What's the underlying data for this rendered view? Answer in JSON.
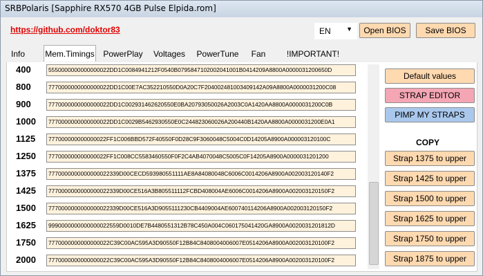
{
  "window": {
    "title": "SRBPolaris [Sapphire RX570 4GB Pulse Elpida.rom]"
  },
  "header": {
    "link": "https://github.com/doktor83",
    "language": "EN",
    "open_bios": "Open BIOS",
    "save_bios": "Save BIOS"
  },
  "tabs": [
    "Info",
    "Mem.Timings",
    "PowerPlay",
    "Voltages",
    "PowerTune",
    "Fan",
    "!IMPORTANT!"
  ],
  "active_tab": "Mem.Timings",
  "timings": [
    {
      "freq": "400",
      "strap": "5550000000000000022DD1C0084941212F0540B0795847102002041001B0414209A8800A0000031200650D"
    },
    {
      "freq": "800",
      "strap": "7770000000000000022DD1C00E7AC352210550D0A20C7F204002481003409142A09A8800A0000031200C08"
    },
    {
      "freq": "900",
      "strap": "7770000000000000022DD1C002931462620550E0BA20793050026A2003C0A1420AA8800A0000031200C0B"
    },
    {
      "freq": "1000",
      "strap": "7770000000000000022DD1C0029B5462930550E0C244823060026A200440B1420AA8800A0000031200E0A1"
    },
    {
      "freq": "1125",
      "strap": "777000000000000022FF1C006BBD572F40550F0D28C9F3060048C5004C0D14205A8900A000003120100C"
    },
    {
      "freq": "1250",
      "strap": "777000000000000022FF1C008CC5583460550F0F2C4AB4070048C5005C0F14205A8900A0000031201200"
    },
    {
      "freq": "1375",
      "strap": "7770000000000000022339D00CECD593980551111AE8A84080048C6006C0014206A8900A002003120140F2"
    },
    {
      "freq": "1425",
      "strap": "7770000000000000022339D00CE516A3B805511112FCBD408004AE6006C0014206A8900A002003120150F2"
    },
    {
      "freq": "1500",
      "strap": "7770000000000000022339D00CE516A3D9055111230CB4409004AE600740114206A8900A002003120150F2"
    },
    {
      "freq": "1625",
      "strap": "9990000000000000022559D0010DE7B4480551312B78C450A004C060175041420GA8900A0020031201812D"
    },
    {
      "freq": "1750",
      "strap": "7770000000000000022C39C00AC595A3D90550F12B84C8408004006007E0514206A8900A002003120100F2"
    },
    {
      "freq": "2000",
      "strap": "7770000000000000022C39C00AC595A3D90550F12B84C8408004006007E0514206A8900A002003120100F2"
    }
  ],
  "actions": {
    "default_values": "Default values",
    "strap_editor": "STRAP EDITOR",
    "pimp_my_straps": "PIMP MY STRAPS",
    "copy_heading": "COPY",
    "copy_buttons": [
      "Strap 1375 to upper",
      "Strap 1425 to upper",
      "Strap 1500 to upper",
      "Strap 1625 to upper",
      "Strap 1750 to upper",
      "Strap 1875 to upper"
    ]
  },
  "colors": {
    "button_peach": "#ffd9b0",
    "strap_editor_pink": "#f4a6b4",
    "pimp_blue": "#a9c8ec",
    "link_red": "#e00000",
    "field_bg": "#fff2dd"
  }
}
